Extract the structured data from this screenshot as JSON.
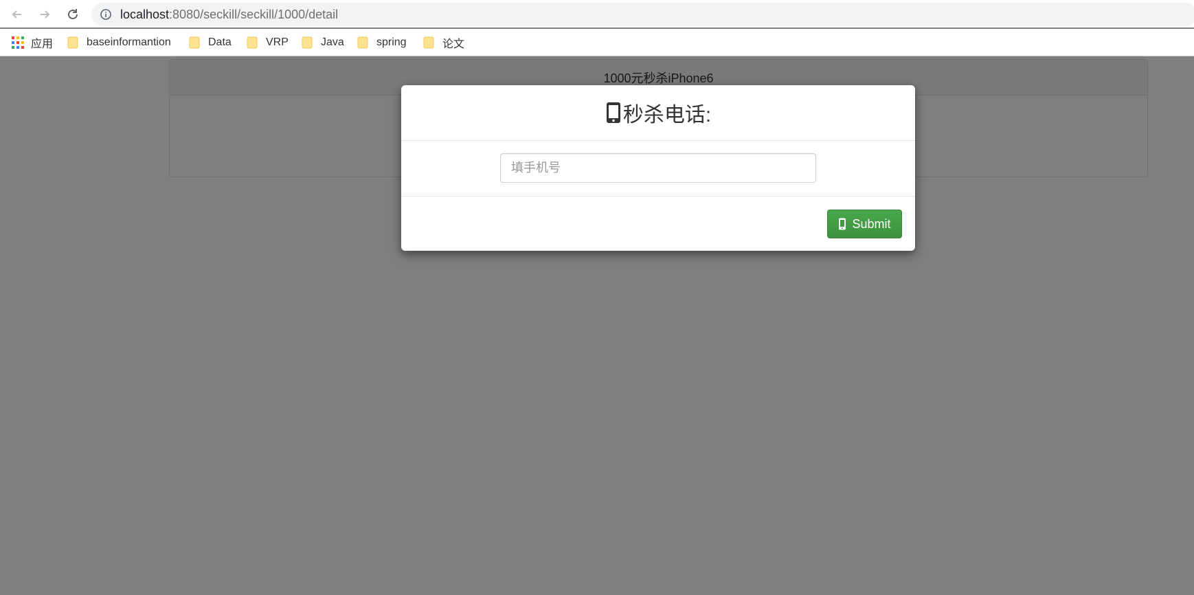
{
  "browser": {
    "url_host": "localhost",
    "url_path": ":8080/seckill/seckill/1000/detail",
    "bookmarks": [
      {
        "label": "应用",
        "type": "apps"
      },
      {
        "label": "baseinformantion",
        "type": "folder"
      },
      {
        "label": "Data",
        "type": "folder"
      },
      {
        "label": "VRP",
        "type": "folder"
      },
      {
        "label": "Java",
        "type": "folder"
      },
      {
        "label": "spring",
        "type": "folder"
      },
      {
        "label": "论文",
        "type": "folder"
      }
    ],
    "folder_color": "#fdd663"
  },
  "page": {
    "panel_title": "1000元秒杀iPhone6"
  },
  "modal": {
    "title": "秒杀电话:",
    "title_icon": "mobile-phone-icon",
    "input_placeholder": "填手机号",
    "input_value": "",
    "submit_label": "Submit",
    "submit_icon": "mobile-phone-icon",
    "submit_color": "#449d44"
  }
}
